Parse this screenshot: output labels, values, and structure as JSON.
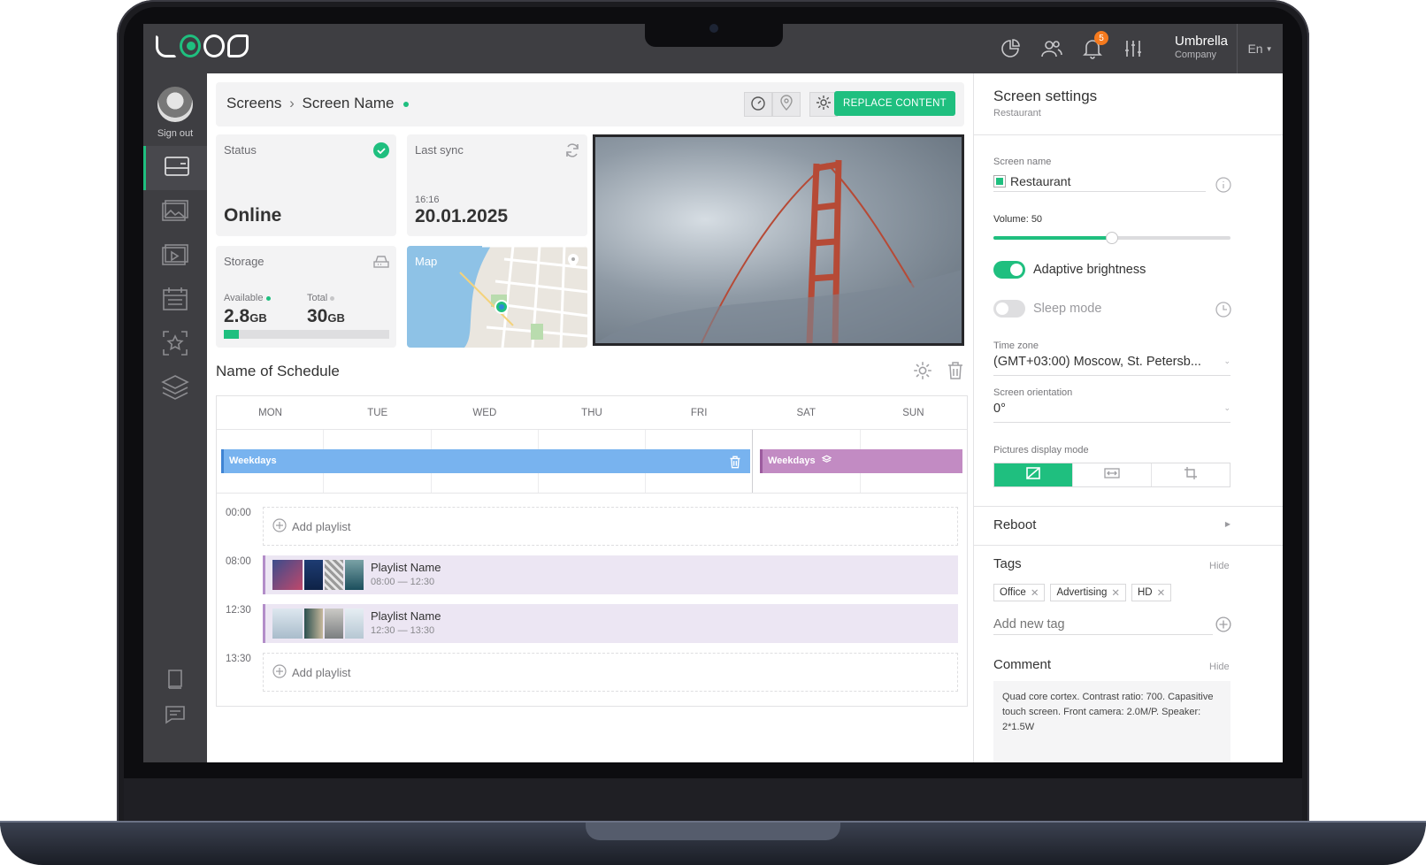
{
  "app": {
    "logo": "LOOK"
  },
  "topbar": {
    "notifications_count": "5",
    "user_name": "Umbrella",
    "user_role": "Company",
    "language": "En"
  },
  "sidebar": {
    "sign_out": "Sign out"
  },
  "header": {
    "crumb_root": "Screens",
    "crumb_sep": "›",
    "crumb_current": "Screen Name",
    "replace_label": "REPLACE CONTENT"
  },
  "status": {
    "label": "Status",
    "value": "Online"
  },
  "sync": {
    "label": "Last sync",
    "time": "16:16",
    "date": "20.01.2025"
  },
  "storage": {
    "label": "Storage",
    "available_label": "Available",
    "available_value": "2.8",
    "available_unit": "GB",
    "total_label": "Total",
    "total_value": "30",
    "total_unit": "GB",
    "used_fraction": 0.09
  },
  "map": {
    "label": "Map"
  },
  "schedule": {
    "title": "Name of Schedule",
    "days": [
      "MON",
      "TUE",
      "WED",
      "THU",
      "FRI",
      "SAT",
      "SUN"
    ],
    "bar_weekdays": "Weekdays",
    "bar_weekend": "Weekdays",
    "rows": [
      {
        "time": "00:00",
        "type": "add",
        "label": "Add playlist"
      },
      {
        "time": "08:00",
        "type": "playlist",
        "name": "Playlist Name",
        "range": "08:00 — 12:30"
      },
      {
        "time": "12:30",
        "type": "playlist",
        "name": "Playlist Name",
        "range": "12:30 — 13:30"
      },
      {
        "time": "13:30",
        "type": "add",
        "label": "Add playlist"
      }
    ]
  },
  "settings": {
    "title": "Screen settings",
    "subtitle": "Restaurant",
    "screen_name_label": "Screen name",
    "screen_name_value": "Restaurant",
    "volume_label": "Volume:",
    "volume_value": "50",
    "adaptive_label": "Adaptive brightness",
    "adaptive_on": true,
    "sleep_label": "Sleep mode",
    "sleep_on": false,
    "timezone_label": "Time zone",
    "timezone_value": "(GMT+03:00) Moscow, St. Petersb...",
    "orientation_label": "Screen orientation",
    "orientation_value": "0°",
    "display_mode_label": "Pictures display mode",
    "reboot_label": "Reboot",
    "tags_label": "Tags",
    "tags_hide": "Hide",
    "tags": [
      "Office",
      "Advertising",
      "HD"
    ],
    "add_tag_placeholder": "Add new tag",
    "comment_label": "Comment",
    "comment_hide": "Hide",
    "comment_text": "Quad core cortex. Contrast ratio: 700. Capasitive touch screen. Front camera: 2.0M/P. Speaker: 2*1.5W"
  },
  "colors": {
    "accent": "#1fbf7f",
    "sidebar": "#3e3e42",
    "badge": "#f57a1e",
    "weekday_bar": "#78b3ef",
    "weekend_bar": "#c28bc3"
  }
}
